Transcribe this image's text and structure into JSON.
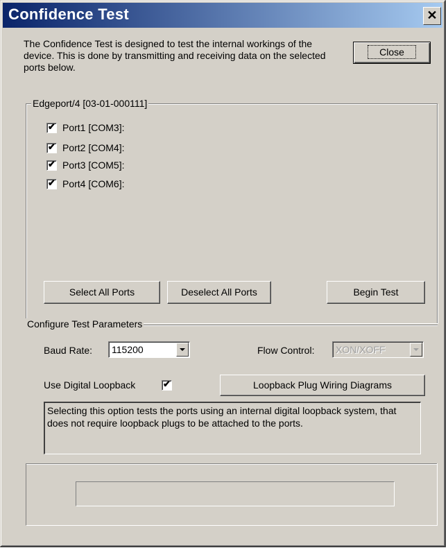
{
  "window": {
    "title": "Confidence Test",
    "close_glyph": "✕"
  },
  "description": "The Confidence Test is designed to test the internal workings of the device. This is done by transmitting and receiving data on the selected ports below.",
  "buttons": {
    "close": "Close",
    "select_all": "Select All Ports",
    "deselect_all": "Deselect All Ports",
    "begin_test": "Begin Test",
    "wiring_diagrams": "Loopback Plug Wiring Diagrams"
  },
  "device_group": {
    "label": "Edgeport/4 [03-01-000111]",
    "ports": [
      {
        "label": "Port1 [COM3]:",
        "checked": true
      },
      {
        "label": "Port2 [COM4]:",
        "checked": true
      },
      {
        "label": "Port3 [COM5]:",
        "checked": true
      },
      {
        "label": "Port4 [COM6]:",
        "checked": true
      }
    ]
  },
  "params": {
    "label": "Configure Test Parameters",
    "baud_label": "Baud Rate:",
    "baud_value": "115200",
    "flow_label": "Flow Control:",
    "flow_value": "XON/XOFF",
    "loopback_label": "Use Digital Loopback",
    "loopback_checked": true,
    "loopback_note": "Selecting this option tests the ports using an internal digital loopback system, that does not require loopback plugs to be attached to the ports."
  },
  "progress": {
    "value": 0
  }
}
